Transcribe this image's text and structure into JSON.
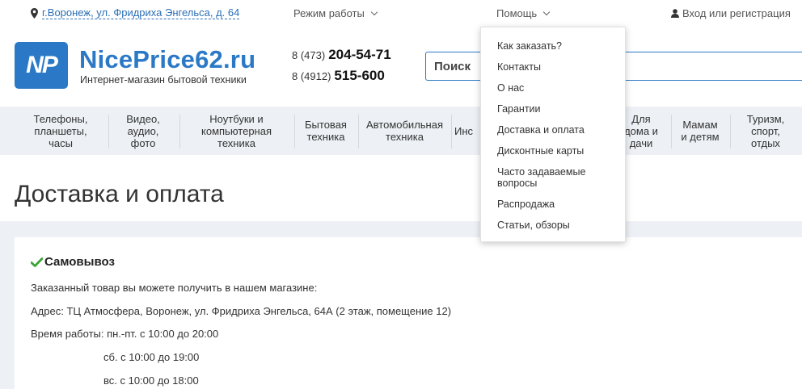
{
  "topbar": {
    "location": "г.Воронеж, ул. Фридриха Энгельса, д. 64",
    "hours_label": "Режим работы",
    "help_label": "Помощь",
    "login_label": "Вход или регистрация",
    "icons": [
      "location-pin-icon",
      "chevron-down-icon",
      "user-icon"
    ]
  },
  "header": {
    "logo_text": "NP",
    "brand": "NicePrice62.ru",
    "tagline": "Интернет-магазин бытовой техники",
    "phones": [
      {
        "code": "8 (473)",
        "number": "204-54-71"
      },
      {
        "code": "8 (4912)",
        "number": "515-600"
      }
    ],
    "search_placeholder": "Поиск",
    "accent_color": "#2b79c6"
  },
  "nav": {
    "items": [
      "Телефоны,\nпланшеты,\nчасы",
      "Видео,\nаудио,\nфото",
      "Ноутбуки и\nкомпьютерная\nтехника",
      "Бытовая\nтехника",
      "Автомобильная\nтехника",
      "Инс",
      "Для\nдома и\nдачи",
      "Мамам\nи детям",
      "Туризм,\nспорт,\nотдых"
    ]
  },
  "page": {
    "title": "Доставка и оплата",
    "section_title": "Самовывоз",
    "lines": [
      "Заказанный товар вы можете получить в нашем магазине:",
      "Адрес: ТЦ Атмосфера, Воронеж, ул. Фридриха Энгельса, 64А (2 этаж, помещение 12)",
      "Время работы: пн.-пт. с 10:00 до 20:00",
      "сб. с 10:00 до 19:00",
      "вс. с 10:00 до 18:00"
    ]
  },
  "dropdown": {
    "items": [
      "Как заказать?",
      "Контакты",
      "О нас",
      "Гарантии",
      "Доставка и оплата",
      "Дисконтные карты",
      "Часто задаваемые\nвопросы",
      "Распродажа",
      "Статьи, обзоры"
    ]
  }
}
